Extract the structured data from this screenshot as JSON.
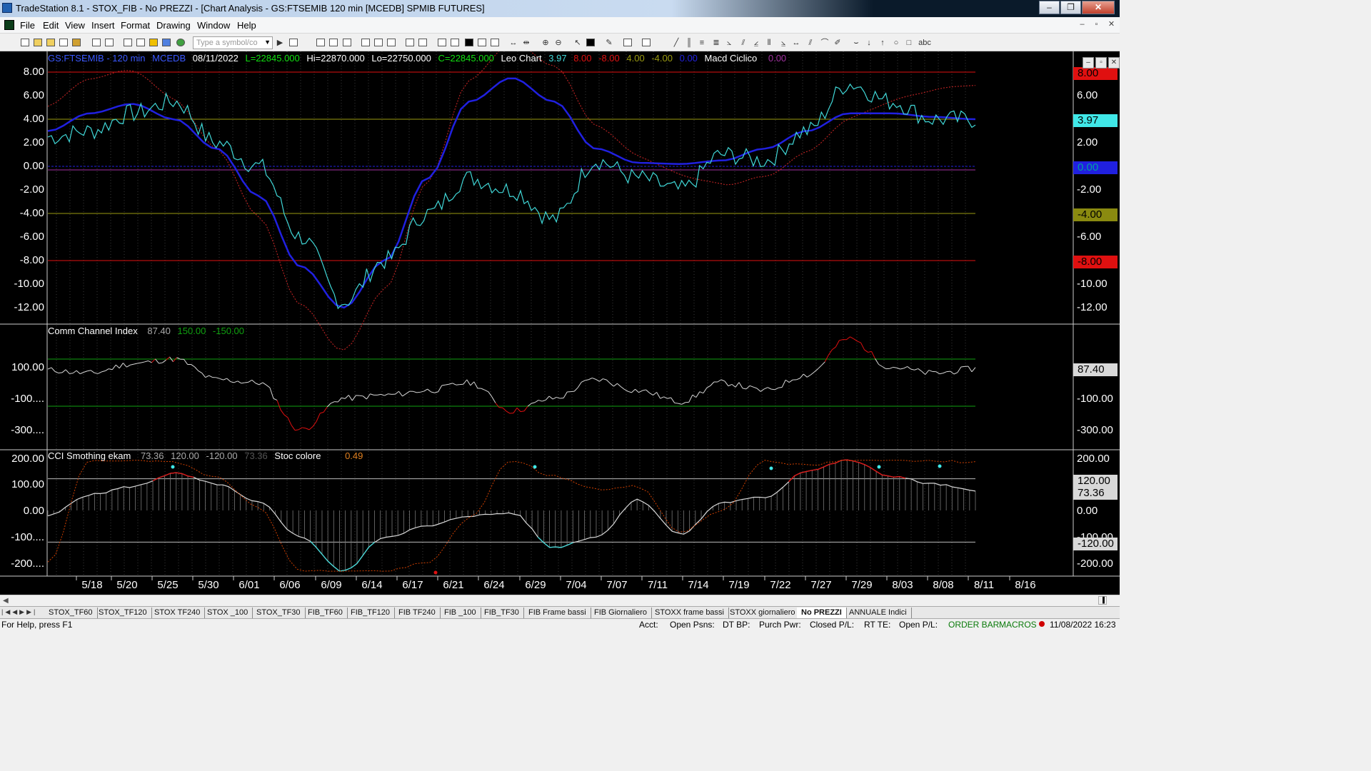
{
  "window": {
    "title": "TradeStation 8.1 - STOX_FIB - No PREZZI - [Chart Analysis - GS:FTSEMIB  120 min  [MCEDB] SPMIB FUTURES]",
    "minimize": "–",
    "restore": "❐",
    "close": "✕"
  },
  "menu": {
    "items": [
      "File",
      "Edit",
      "View",
      "Insert",
      "Format",
      "Drawing",
      "Window",
      "Help"
    ],
    "mdi": [
      "–",
      "▫",
      "✕"
    ]
  },
  "toolbar": {
    "symbol_placeholder": "Type a symbol/co"
  },
  "chart": {
    "header": {
      "symbol": "GS:FTSEMIB - 120 min",
      "study": "MCEDB",
      "date": "08/11/2022",
      "low": "L=22845.000",
      "high": "Hi=22870.000",
      "lo": "Lo=22750.000",
      "close": "C=22845.000",
      "indicator": "Leo Chart",
      "v1": "3.97",
      "v2": "8.00",
      "v3": "-8.00",
      "v4": "4.00",
      "v5": "-4.00",
      "v6": "0.00",
      "indicator2": "Macd Ciclico",
      "v7": "0.00"
    },
    "pane2_header": {
      "name": "Comm Channel Index",
      "v1": "87.40",
      "v2": "150.00",
      "v3": "-150.00"
    },
    "pane3_header": {
      "name": "CCI Smothing ekam",
      "v1": "73.36",
      "v2": "120.00",
      "v3": "-120.00",
      "v4": "73.36",
      "name2": "Stoc colore",
      "v5": "0.49"
    },
    "pane1_yaxis": [
      "8.00",
      "6.00",
      "4.00",
      "2.00",
      "0.00",
      "-2.00",
      "-4.00",
      "-6.00",
      "-8.00",
      "-10.00",
      "-12.00"
    ],
    "pane2_yaxis": [
      "100.00",
      "-100....",
      "-300...."
    ],
    "pane2_yaxis_right": [
      "-100.00",
      "-300.00"
    ],
    "pane3_yaxis": [
      "200.00",
      "100.00",
      "0.00",
      "-100....",
      "-200...."
    ],
    "pane3_yaxis_right": [
      "200.00",
      "0.00",
      "-100.00",
      "-200.00"
    ],
    "pane1_yaxis_right": [
      "6.00",
      "2.00",
      "-2.00",
      "-6.00",
      "-10.00",
      "-12.00"
    ],
    "tags": {
      "p1_8": "8.00",
      "p1_cur": "3.97",
      "p1_0": "0.00",
      "p1_m4": "-4.00",
      "p1_m8": "-8.00",
      "p2_cur": "87.40",
      "p3_120": "120.00",
      "p3_cur": "73.36",
      "p3_m120": "-120.00"
    },
    "xaxis": [
      "5/18",
      "5/20",
      "5/25",
      "5/30",
      "6/01",
      "6/06",
      "6/09",
      "6/14",
      "6/17",
      "6/21",
      "6/24",
      "6/29",
      "7/04",
      "7/07",
      "7/11",
      "7/14",
      "7/19",
      "7/22",
      "7/27",
      "7/29",
      "8/03",
      "8/08",
      "8/11",
      "8/16"
    ],
    "colors": {
      "price": "#40d8d8",
      "cycle": "#2020e0",
      "dotted": "#b02020",
      "red_line": "#e01010",
      "olive": "#9a9a10",
      "zero": "#2020e0",
      "green": "#10a010"
    },
    "chart_data": [
      {
        "type": "line",
        "title": "Leo Chart",
        "x": [
          "5/18",
          "5/20",
          "5/25",
          "5/30",
          "6/01",
          "6/06",
          "6/09",
          "6/14",
          "6/17",
          "6/21",
          "6/24",
          "6/29",
          "7/04",
          "7/07",
          "7/11",
          "7/14",
          "7/19",
          "7/22",
          "7/27",
          "7/29",
          "8/03",
          "8/08",
          "8/11"
        ],
        "series": [
          {
            "name": "Leo Chart",
            "values": [
              2.5,
              3.0,
              4.5,
              5.5,
              2.0,
              0.0,
              -6.0,
              -11.5,
              -8.0,
              -4.0,
              -1.0,
              -2.0,
              -4.5,
              0.5,
              -1.0,
              -2.0,
              1.0,
              0.5,
              3.0,
              7.0,
              5.5,
              4.0,
              3.97
            ]
          },
          {
            "name": "Macd Ciclico",
            "values": [
              3.0,
              4.5,
              5.3,
              4.0,
              1.5,
              -2.5,
              -8.5,
              -12.0,
              -8.0,
              -1.0,
              5.5,
              7.5,
              5.5,
              1.5,
              0.3,
              0.2,
              0.5,
              1.5,
              3.0,
              4.5,
              4.5,
              4.2,
              4.0
            ]
          }
        ],
        "ylim": [
          -12,
          8
        ]
      },
      {
        "type": "line",
        "title": "Comm Channel Index",
        "x": [
          "5/18",
          "5/20",
          "5/25",
          "5/30",
          "6/01",
          "6/06",
          "6/09",
          "6/14",
          "6/17",
          "6/21",
          "6/24",
          "6/29",
          "7/04",
          "7/07",
          "7/11",
          "7/14",
          "7/19",
          "7/22",
          "7/27",
          "7/29",
          "8/03",
          "8/08",
          "8/11"
        ],
        "series": [
          {
            "name": "Comm Channel Index",
            "values": [
              80,
              60,
              120,
              150,
              20,
              0,
              -300,
              -100,
              -80,
              -50,
              0,
              -180,
              -100,
              20,
              -50,
              -120,
              0,
              -50,
              50,
              280,
              100,
              60,
              87.4
            ]
          }
        ],
        "ylim": [
          -300,
          250
        ]
      },
      {
        "type": "line",
        "title": "CCI Smothing ekam",
        "x": [
          "5/18",
          "5/20",
          "5/25",
          "5/30",
          "6/01",
          "6/06",
          "6/09",
          "6/14",
          "6/17",
          "6/21",
          "6/24",
          "6/29",
          "7/04",
          "7/07",
          "7/11",
          "7/14",
          "7/19",
          "7/22",
          "7/27",
          "7/29",
          "8/03",
          "8/08",
          "8/11"
        ],
        "series": [
          {
            "name": "CCI Smothing ekam",
            "values": [
              -20,
              60,
              90,
              140,
              100,
              30,
              -100,
              -230,
              -100,
              -60,
              -20,
              -10,
              -140,
              -100,
              40,
              -90,
              30,
              50,
              150,
              190,
              130,
              100,
              73.36
            ]
          }
        ],
        "ylim": [
          -230,
          200
        ]
      }
    ]
  },
  "tabs": [
    "STOX_TF60",
    "STOX_TF120",
    "STOX TF240",
    "STOX _100",
    "STOX_TF30",
    "FIB_TF60",
    "FIB_TF120",
    "FIB TF240",
    "FIB _100",
    "FIB_TF30",
    "FIB Frame bassi",
    "FIB Giornaliero",
    "STOXX frame bassi",
    "STOXX giornaliero",
    "No PREZZI",
    "ANNUALE Indici"
  ],
  "status": {
    "help": "For Help, press F1",
    "acct": "Acct:",
    "open_psns": "Open Psns:",
    "dt_bp": "DT BP:",
    "purch_pwr": "Purch Pwr:",
    "closed_pl": "Closed P/L:",
    "rt_te": "RT TE:",
    "open_pl": "Open P/L:",
    "orderbar": "ORDER BAR",
    "macros": "MACROS",
    "datetime": "11/08/2022 16:23"
  }
}
